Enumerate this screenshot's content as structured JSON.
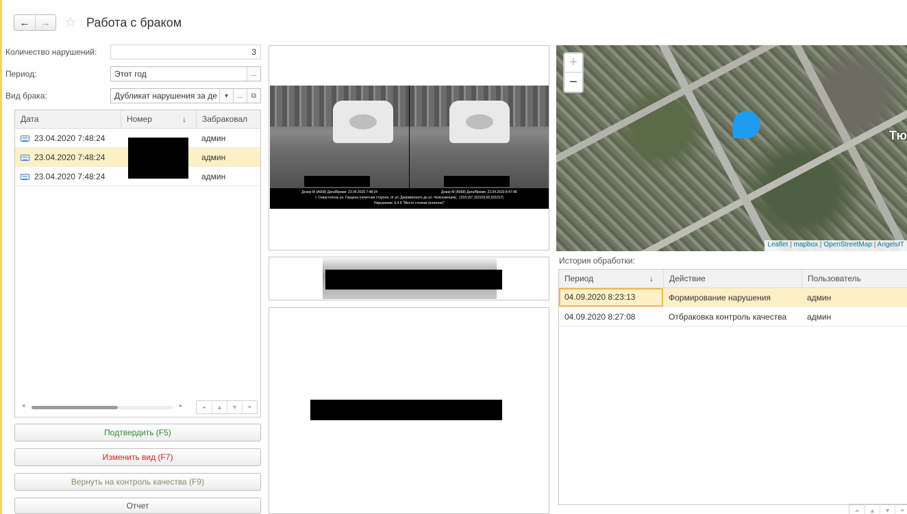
{
  "header": {
    "back_icon": "←",
    "forward_icon": "→",
    "star_icon": "☆",
    "title": "Работа с браком"
  },
  "form": {
    "violations_label": "Количество нарушений:",
    "violations_value": "3",
    "period_label": "Период:",
    "period_value": "Этот год",
    "defect_label": "Вид брака:",
    "defect_value": "Дубликат нарушения за де"
  },
  "left_table": {
    "columns": [
      "Дата",
      "Номер",
      "Забраковал"
    ],
    "sort_icon": "↓",
    "rows": [
      {
        "date": "23.04.2020 7:48:24",
        "number": "",
        "user": "админ"
      },
      {
        "date": "23.04.2020 7:48:24",
        "number": "",
        "user": "админ"
      },
      {
        "date": "23.04.2020 7:48:24",
        "number": "",
        "user": "админ"
      }
    ]
  },
  "buttons": {
    "confirm": "Подтвердить (F5)",
    "change": "Изменить вид (F7)",
    "return": "Вернуть на контроль качества (F9)",
    "report": "Отчет"
  },
  "photo": {
    "caption_left": "Дозор М (A668) Дата/Время: 23.04.2020 7:48:24",
    "caption_right": "Дозор М (A668) Дата/Время: 23.04.2020 8:47:48",
    "caption_line2": "г. Севастополь ул. Герцена (нечетная сторона, от ул. Дзержинского до ул. Челюскинцев) . (102) [57,153163,65,531017]",
    "caption_line3": "Нарушение: 6.4.6 \"Место стоянки (платное)\""
  },
  "map": {
    "zoom_in": "+",
    "zoom_out": "−",
    "city_label": "Тю",
    "attribution": [
      "Leaflet",
      "mapbox",
      "OpenStreetMap",
      "AngelsIT"
    ]
  },
  "history": {
    "label": "История обработки:",
    "columns": [
      "Период",
      "Действие",
      "Пользователь"
    ],
    "sort_icon": "↓",
    "rows": [
      {
        "period": "04.09.2020 8:23:13",
        "action": "Формирование нарушения",
        "user": "админ"
      },
      {
        "period": "04.09.2020 8:27:08",
        "action": "Отбраковка контроль качества",
        "user": "админ"
      }
    ]
  },
  "nav_icons": [
    "⏶",
    "▲",
    "▼",
    "⏷"
  ],
  "colors": {
    "accent_yellow": "#fdf0c7",
    "confirm_green": "#2e8b2e",
    "change_red": "#d22222",
    "return_gray": "#8a8a6a",
    "map_pin": "#1e9cf0"
  }
}
